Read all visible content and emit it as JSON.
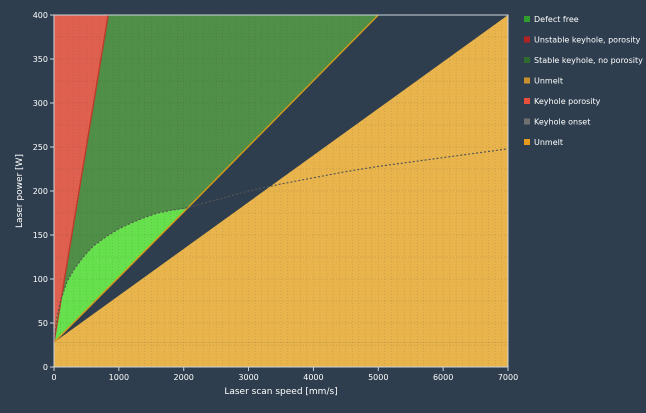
{
  "chart_data": {
    "type": "area",
    "title": "",
    "xlabel": "Laser scan speed [mm/s]",
    "ylabel": "Laser power [W]",
    "xlim": [
      0,
      7000
    ],
    "ylim": [
      0,
      400
    ],
    "xticks": [
      0,
      1000,
      2000,
      3000,
      4000,
      5000,
      6000,
      7000
    ],
    "yticks": [
      0,
      50,
      100,
      150,
      200,
      250,
      300,
      350,
      400
    ],
    "grid": true,
    "legend_position": "right",
    "regions": [
      {
        "name": "Unmelt",
        "color": "#e9b44c",
        "polygon": [
          [
            0,
            28
          ],
          [
            7000,
            28
          ],
          [
            7000,
            0
          ],
          [
            0,
            0
          ]
        ]
      },
      {
        "name": "Unmelt",
        "color": "#e9b44c",
        "polygon": [
          [
            0,
            28
          ],
          [
            7000,
            400
          ],
          [
            7000,
            28
          ]
        ]
      },
      {
        "name": "Stable keyhole, no porosity",
        "color": "#4f8f47",
        "polygon": [
          [
            0,
            28
          ],
          [
            835,
            400
          ],
          [
            5000,
            400
          ],
          [
            2050,
            180
          ]
        ]
      },
      {
        "name": "Keyhole porosity",
        "color": "#e06050",
        "polygon": [
          [
            0,
            28
          ],
          [
            0,
            400
          ],
          [
            835,
            400
          ]
        ]
      },
      {
        "name": "Defect free",
        "color": "#66e04c",
        "polygon": [
          [
            0,
            28
          ],
          [
            40,
            55
          ],
          [
            100,
            75
          ],
          [
            200,
            97
          ],
          [
            300,
            110
          ],
          [
            450,
            125
          ],
          [
            600,
            137
          ],
          [
            800,
            148
          ],
          [
            1000,
            157
          ],
          [
            1200,
            164
          ],
          [
            1400,
            170
          ],
          [
            1600,
            175
          ],
          [
            1800,
            178
          ],
          [
            2050,
            180
          ]
        ]
      }
    ],
    "lines": [
      {
        "name": "Unmelt",
        "color": "#d69a1a",
        "points": [
          [
            0,
            28
          ],
          [
            2050,
            180
          ],
          [
            5000,
            400
          ]
        ]
      },
      {
        "name": "Unstable keyhole, porosity",
        "color": "#c0392b",
        "points": [
          [
            0,
            28
          ],
          [
            835,
            400
          ]
        ]
      },
      {
        "name": "Keyhole onset",
        "color": "#555555",
        "dash": true,
        "points": [
          [
            0,
            28
          ],
          [
            40,
            55
          ],
          [
            100,
            75
          ],
          [
            200,
            97
          ],
          [
            300,
            110
          ],
          [
            450,
            125
          ],
          [
            600,
            137
          ],
          [
            800,
            148
          ],
          [
            1000,
            157
          ],
          [
            1200,
            164
          ],
          [
            1400,
            170
          ],
          [
            1600,
            175
          ],
          [
            1800,
            178
          ],
          [
            2050,
            181
          ],
          [
            2500,
            190
          ],
          [
            3000,
            200
          ],
          [
            3500,
            208
          ],
          [
            4000,
            215
          ],
          [
            4500,
            222
          ],
          [
            5000,
            228
          ],
          [
            5500,
            233
          ],
          [
            6000,
            238
          ],
          [
            6500,
            243
          ],
          [
            7000,
            248
          ]
        ]
      }
    ],
    "legend": [
      {
        "label": "Defect free",
        "color": "#2f9e2f"
      },
      {
        "label": "Unstable keyhole, porosity",
        "color": "#b22222"
      },
      {
        "label": "Stable keyhole, no porosity",
        "color": "#2f6b2f"
      },
      {
        "label": "Unmelt",
        "color": "#c8912e"
      },
      {
        "label": "Keyhole porosity",
        "color": "#e8503c"
      },
      {
        "label": "Keyhole onset",
        "color": "#707070"
      },
      {
        "label": "Unmelt",
        "color": "#e59a1c"
      }
    ]
  }
}
